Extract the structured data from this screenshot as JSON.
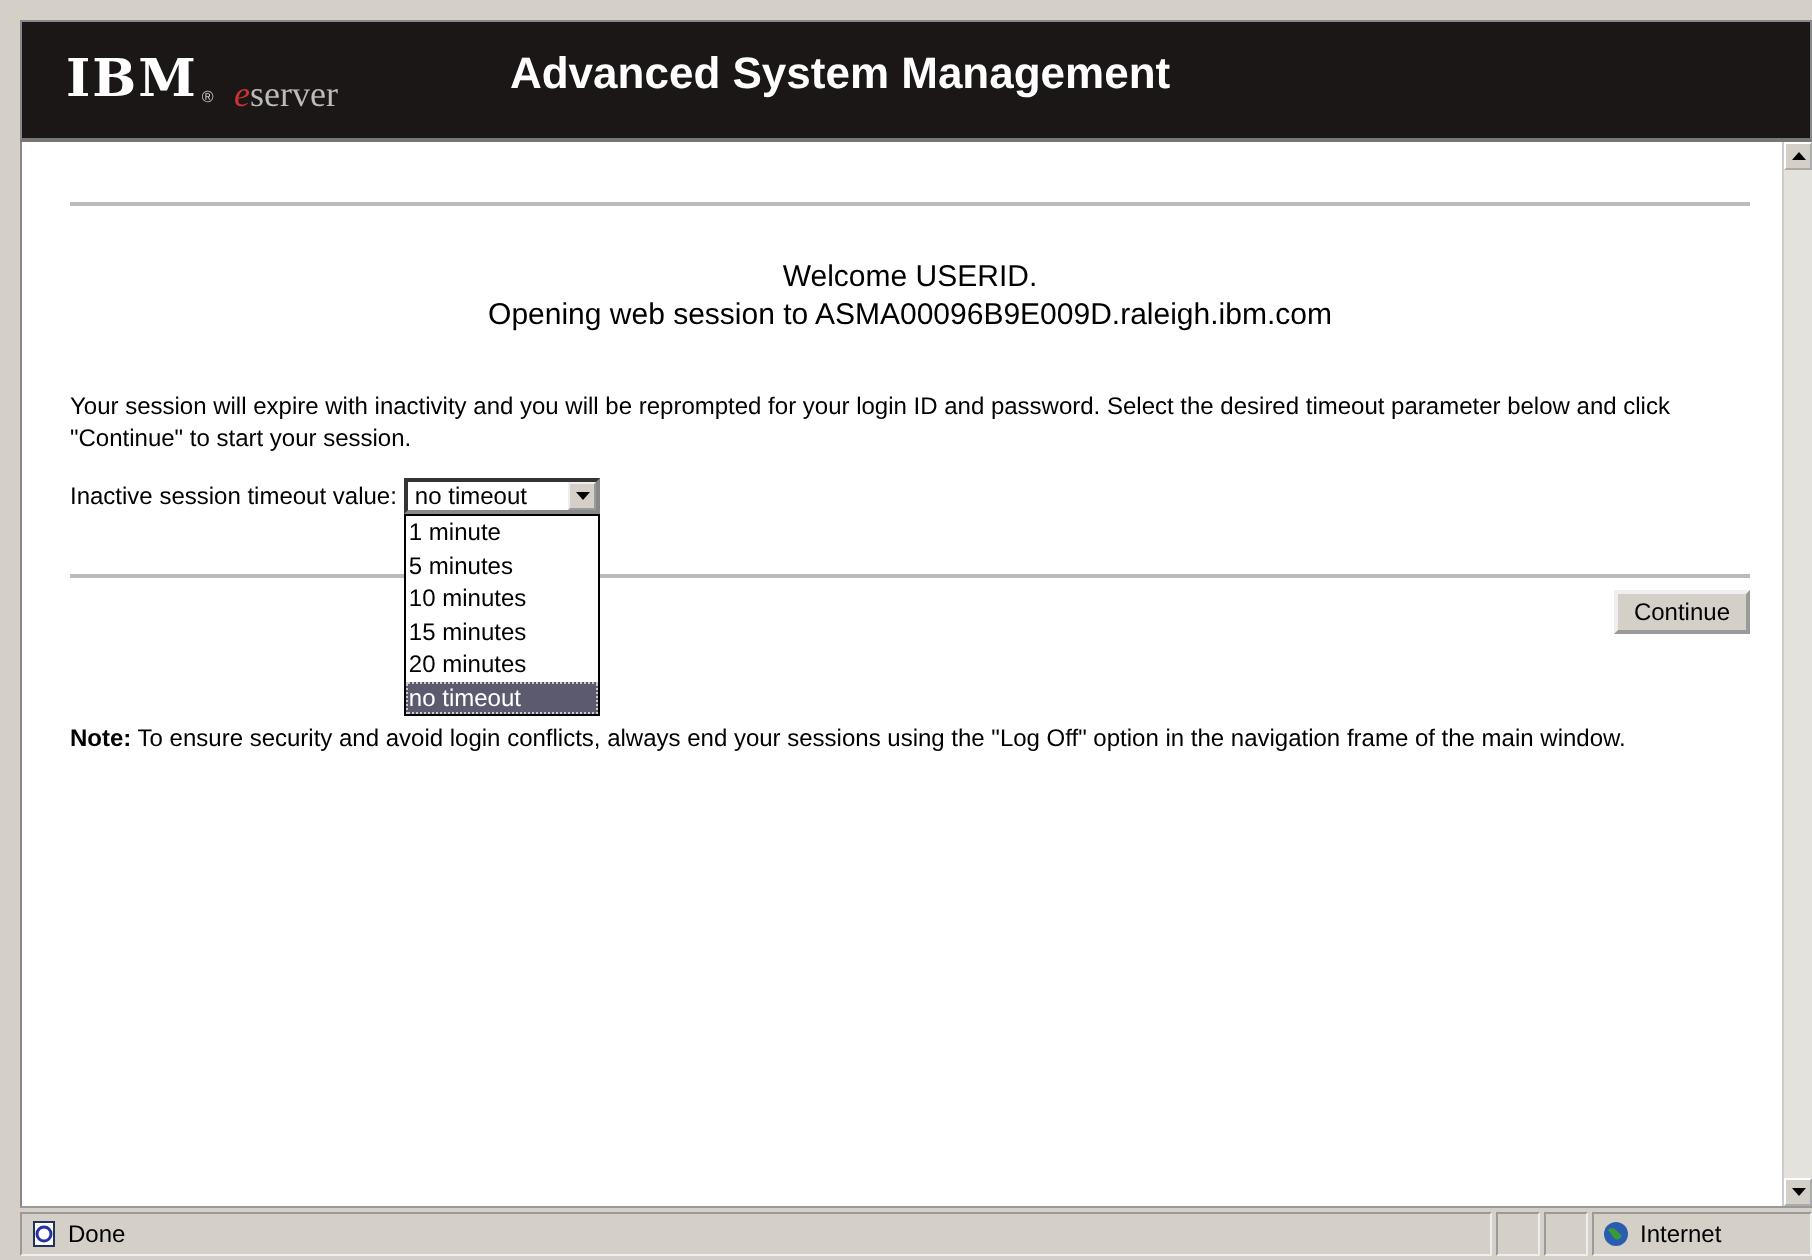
{
  "header": {
    "logo": "IBM",
    "logo_mark": "®",
    "brand_prefix": "e",
    "brand": "server",
    "title": "Advanced System Management"
  },
  "welcome": [
    "Welcome USERID.",
    "Opening web session to ASMA00096B9E009D.raleigh.ibm.com"
  ],
  "intro": "Your session will expire with inactivity and you will be reprompted for your login ID and password. Select the desired timeout parameter below and click \"Continue\" to start your session.",
  "timeout": {
    "label": "Inactive session timeout value:",
    "value": "no timeout",
    "expanded": true,
    "options": [
      {
        "label": "1 minute",
        "selected": false
      },
      {
        "label": "5 minutes",
        "selected": false
      },
      {
        "label": "10 minutes",
        "selected": false
      },
      {
        "label": "15 minutes",
        "selected": false
      },
      {
        "label": "20 minutes",
        "selected": false
      },
      {
        "label": "no timeout",
        "selected": true
      }
    ]
  },
  "continue_button": "Continue",
  "note": "**Note:** To ensure security and avoid login conflicts, always end your sessions using the \"Log Off\" option in the navigation frame of the main window.",
  "status_bar": {
    "status": "Done",
    "zone": "Internet"
  }
}
